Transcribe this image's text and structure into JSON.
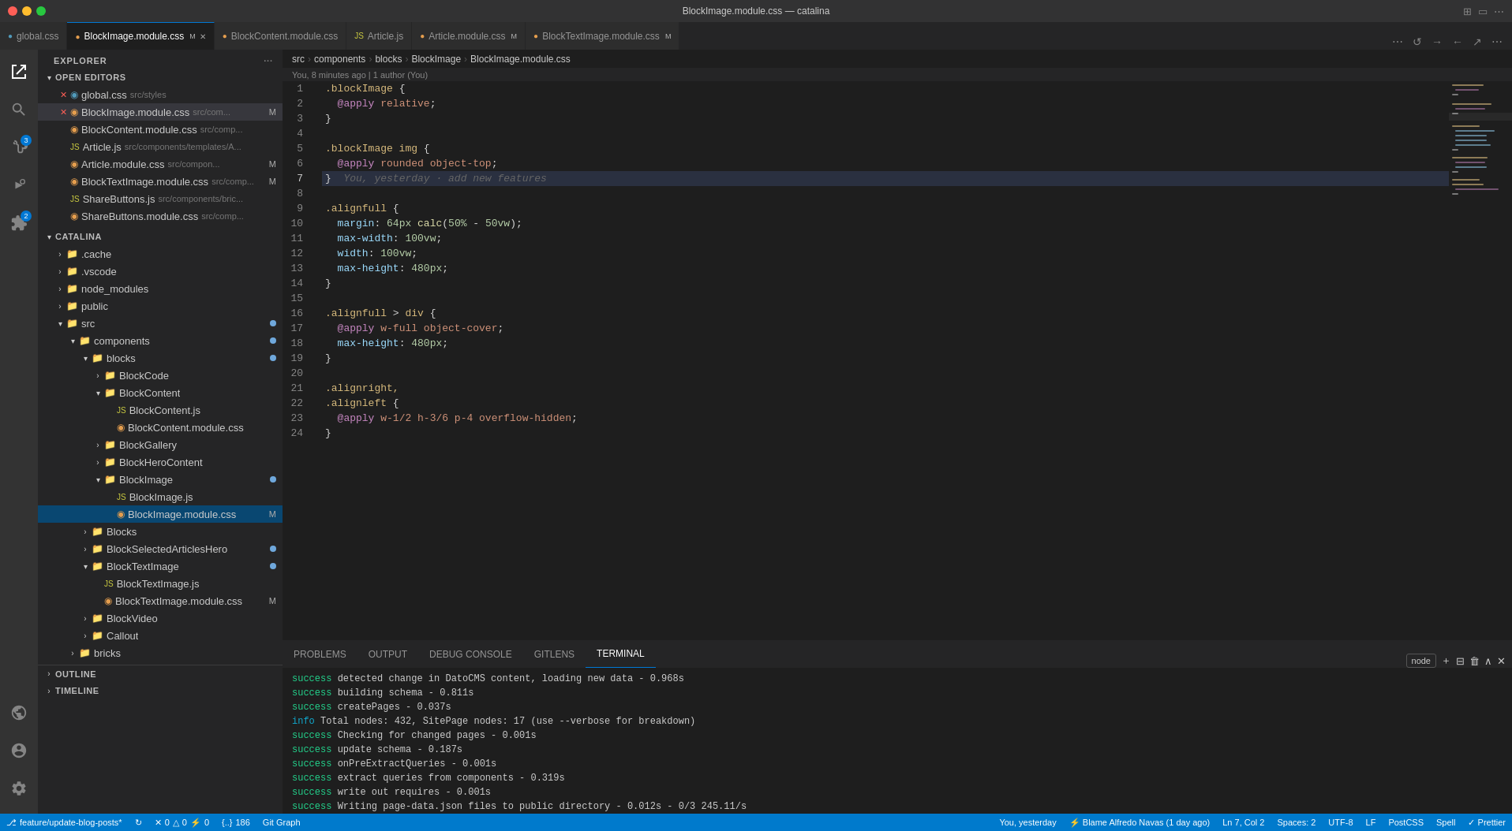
{
  "titleBar": {
    "title": "BlockImage.module.css — catalina",
    "trafficLights": [
      "close",
      "minimize",
      "maximize"
    ]
  },
  "tabs": [
    {
      "id": "global-css",
      "label": "global.css",
      "type": "css",
      "modified": false,
      "active": false
    },
    {
      "id": "blockimage-module-css",
      "label": "BlockImage.module.css",
      "type": "css",
      "modified": true,
      "active": true
    },
    {
      "id": "blockcontent-module-css",
      "label": "BlockContent.module.css",
      "type": "css",
      "modified": false,
      "active": false
    },
    {
      "id": "article-js",
      "label": "Article.js",
      "type": "js",
      "modified": false,
      "active": false
    },
    {
      "id": "article-module-css",
      "label": "Article.module.css",
      "type": "css",
      "modified": true,
      "active": false
    },
    {
      "id": "blocktextimage-module-css",
      "label": "BlockTextImage.module.css",
      "type": "css",
      "modified": true,
      "active": false
    }
  ],
  "activityBar": {
    "icons": [
      {
        "name": "explorer",
        "label": "Explorer",
        "active": true,
        "badge": null
      },
      {
        "name": "search",
        "label": "Search",
        "active": false,
        "badge": null
      },
      {
        "name": "source-control",
        "label": "Source Control",
        "active": false,
        "badge": "3"
      },
      {
        "name": "run",
        "label": "Run",
        "active": false,
        "badge": null
      },
      {
        "name": "extensions",
        "label": "Extensions",
        "active": false,
        "badge": "2"
      },
      {
        "name": "remote",
        "label": "Remote Explorer",
        "active": false,
        "badge": null
      }
    ]
  },
  "sidebar": {
    "title": "EXPLORER",
    "sections": {
      "openEditors": {
        "title": "OPEN EDITORS",
        "files": [
          {
            "name": "global.css",
            "path": "src/styles",
            "type": "css",
            "modified": false,
            "indent": 1
          },
          {
            "name": "BlockImage.module.css",
            "path": "src/com...",
            "type": "css",
            "modified": true,
            "active": true,
            "indent": 1
          },
          {
            "name": "BlockContent.module.css",
            "path": "src/comp...",
            "type": "css",
            "modified": false,
            "indent": 1
          },
          {
            "name": "Article.js",
            "path": "src/components/templates/A...",
            "type": "js",
            "modified": false,
            "indent": 1
          },
          {
            "name": "Article.module.css",
            "path": "src/compon...",
            "type": "css",
            "modified": true,
            "indent": 1
          },
          {
            "name": "BlockTextImage.module.css",
            "path": "src/comp...",
            "type": "css",
            "modified": true,
            "indent": 1
          },
          {
            "name": "ShareButtons.js",
            "path": "src/components/bric...",
            "type": "js",
            "modified": false,
            "indent": 1
          },
          {
            "name": "ShareButtons.module.css",
            "path": "src/comp...",
            "type": "css",
            "modified": false,
            "indent": 1
          }
        ]
      },
      "catalina": {
        "title": "CATALINA",
        "tree": [
          {
            "name": ".cache",
            "type": "folder",
            "indent": 1,
            "collapsed": true
          },
          {
            "name": ".vscode",
            "type": "folder",
            "indent": 1,
            "collapsed": true
          },
          {
            "name": "node_modules",
            "type": "folder",
            "indent": 1,
            "collapsed": true
          },
          {
            "name": "public",
            "type": "folder",
            "indent": 1,
            "collapsed": true
          },
          {
            "name": "src",
            "type": "folder-src",
            "indent": 1,
            "collapsed": false,
            "dirty": true
          },
          {
            "name": "components",
            "type": "folder-src",
            "indent": 2,
            "collapsed": false,
            "dirty": true
          },
          {
            "name": "blocks",
            "type": "folder-src",
            "indent": 3,
            "collapsed": false,
            "dirty": true
          },
          {
            "name": "BlockCode",
            "type": "folder",
            "indent": 4,
            "collapsed": true
          },
          {
            "name": "BlockContent",
            "type": "folder",
            "indent": 4,
            "collapsed": true
          },
          {
            "name": "BlockContent.js",
            "type": "js",
            "indent": 5
          },
          {
            "name": "BlockContent.module.css",
            "type": "css",
            "indent": 5
          },
          {
            "name": "BlockGallery",
            "type": "folder",
            "indent": 4,
            "collapsed": true
          },
          {
            "name": "BlockHeroContent",
            "type": "folder",
            "indent": 4,
            "collapsed": true
          },
          {
            "name": "BlockImage",
            "type": "folder-src",
            "indent": 4,
            "collapsed": false,
            "dirty": true
          },
          {
            "name": "BlockImage.js",
            "type": "js",
            "indent": 5
          },
          {
            "name": "BlockImage.module.css",
            "type": "css",
            "indent": 5,
            "active": true,
            "dirty": true
          },
          {
            "name": "Blocks",
            "type": "folder",
            "indent": 3,
            "collapsed": true
          },
          {
            "name": "BlockSelectedArticlesHero",
            "type": "folder",
            "indent": 3,
            "collapsed": true,
            "dirty": true
          },
          {
            "name": "BlockTextImage",
            "type": "folder",
            "indent": 3,
            "collapsed": true,
            "dirty": true
          },
          {
            "name": "BlockTextImage.js",
            "type": "js",
            "indent": 4
          },
          {
            "name": "BlockTextImage.module.css",
            "type": "css",
            "indent": 4,
            "dirty": true
          },
          {
            "name": "BlockVideo",
            "type": "folder",
            "indent": 3,
            "collapsed": true
          },
          {
            "name": "Callout",
            "type": "folder",
            "indent": 3,
            "collapsed": true
          },
          {
            "name": "bricks",
            "type": "folder",
            "indent": 2,
            "collapsed": true
          }
        ]
      },
      "outline": {
        "title": "OUTLINE"
      },
      "timeline": {
        "title": "TIMELINE"
      }
    }
  },
  "breadcrumb": {
    "parts": [
      "src",
      "components",
      "blocks",
      "BlockImage",
      "BlockImage.module.css"
    ]
  },
  "gitBlame": {
    "text": "You, 8 minutes ago | 1 author (You)"
  },
  "codeLines": [
    {
      "num": 1,
      "tokens": [
        {
          "text": ".blockImage {",
          "class": "css-selector"
        }
      ]
    },
    {
      "num": 2,
      "tokens": [
        {
          "text": "  ",
          "class": ""
        },
        {
          "text": "@apply",
          "class": "css-at"
        },
        {
          "text": " relative",
          "class": "css-value"
        },
        {
          "text": ";",
          "class": "css-punct"
        }
      ]
    },
    {
      "num": 3,
      "tokens": [
        {
          "text": "}",
          "class": "css-punct"
        }
      ]
    },
    {
      "num": 4,
      "tokens": []
    },
    {
      "num": 5,
      "tokens": [
        {
          "text": ".blockImage img {",
          "class": "css-selector"
        }
      ]
    },
    {
      "num": 6,
      "tokens": [
        {
          "text": "  ",
          "class": ""
        },
        {
          "text": "@apply",
          "class": "css-at"
        },
        {
          "text": " rounded object-top",
          "class": "css-value"
        },
        {
          "text": ";",
          "class": "css-punct"
        }
      ]
    },
    {
      "num": 7,
      "tokens": [
        {
          "text": "}",
          "class": "css-punct"
        },
        {
          "text": "  You, yesterday · add new features",
          "class": "inline-ghost"
        }
      ],
      "current": true
    },
    {
      "num": 8,
      "tokens": []
    },
    {
      "num": 9,
      "tokens": [
        {
          "text": ".alignfull {",
          "class": "css-selector"
        }
      ]
    },
    {
      "num": 10,
      "tokens": [
        {
          "text": "  ",
          "class": ""
        },
        {
          "text": "margin",
          "class": "css-property"
        },
        {
          "text": ": ",
          "class": "css-punct"
        },
        {
          "text": "64px",
          "class": "css-value-num"
        },
        {
          "text": " calc(",
          "class": "css-value-func"
        },
        {
          "text": "50%",
          "class": "css-value-num"
        },
        {
          "text": " - ",
          "class": "css-punct"
        },
        {
          "text": "50vw",
          "class": "css-value-num"
        },
        {
          "text": ");",
          "class": "css-punct"
        }
      ]
    },
    {
      "num": 11,
      "tokens": [
        {
          "text": "  ",
          "class": ""
        },
        {
          "text": "max-width",
          "class": "css-property"
        },
        {
          "text": ": ",
          "class": "css-punct"
        },
        {
          "text": "100vw",
          "class": "css-value-num"
        },
        {
          "text": ";",
          "class": "css-punct"
        }
      ]
    },
    {
      "num": 12,
      "tokens": [
        {
          "text": "  ",
          "class": ""
        },
        {
          "text": "width",
          "class": "css-property"
        },
        {
          "text": ": ",
          "class": "css-punct"
        },
        {
          "text": "100vw",
          "class": "css-value-num"
        },
        {
          "text": ";",
          "class": "css-punct"
        }
      ]
    },
    {
      "num": 13,
      "tokens": [
        {
          "text": "  ",
          "class": ""
        },
        {
          "text": "max-height",
          "class": "css-property"
        },
        {
          "text": ": ",
          "class": "css-punct"
        },
        {
          "text": "480px",
          "class": "css-value-num"
        },
        {
          "text": ";",
          "class": "css-punct"
        }
      ]
    },
    {
      "num": 14,
      "tokens": [
        {
          "text": "}",
          "class": "css-punct"
        }
      ]
    },
    {
      "num": 15,
      "tokens": []
    },
    {
      "num": 16,
      "tokens": [
        {
          "text": ".alignfull > div {",
          "class": "css-selector"
        }
      ]
    },
    {
      "num": 17,
      "tokens": [
        {
          "text": "  ",
          "class": ""
        },
        {
          "text": "@apply",
          "class": "css-at"
        },
        {
          "text": " w-full object-cover",
          "class": "css-value"
        },
        {
          "text": ";",
          "class": "css-punct"
        }
      ]
    },
    {
      "num": 18,
      "tokens": [
        {
          "text": "  ",
          "class": ""
        },
        {
          "text": "max-height",
          "class": "css-property"
        },
        {
          "text": ": ",
          "class": "css-punct"
        },
        {
          "text": "480px",
          "class": "css-value-num"
        },
        {
          "text": ";",
          "class": "css-punct"
        }
      ]
    },
    {
      "num": 19,
      "tokens": [
        {
          "text": "}",
          "class": "css-punct"
        }
      ]
    },
    {
      "num": 20,
      "tokens": []
    },
    {
      "num": 21,
      "tokens": [
        {
          "text": ".alignright,",
          "class": "css-selector"
        }
      ]
    },
    {
      "num": 22,
      "tokens": [
        {
          "text": ".alignleft {",
          "class": "css-selector"
        }
      ]
    },
    {
      "num": 23,
      "tokens": [
        {
          "text": "  ",
          "class": ""
        },
        {
          "text": "@apply",
          "class": "css-at"
        },
        {
          "text": " w-1/2 h-3/6 p-4 overflow-hidden",
          "class": "css-value"
        },
        {
          "text": ";",
          "class": "css-punct"
        }
      ]
    },
    {
      "num": 24,
      "tokens": [
        {
          "text": "}",
          "class": "css-punct"
        }
      ]
    }
  ],
  "terminal": {
    "tabs": [
      "PROBLEMS",
      "OUTPUT",
      "DEBUG CONSOLE",
      "GITLENS",
      "TERMINAL"
    ],
    "activeTab": "TERMINAL",
    "lines": [
      {
        "type": "success",
        "text": "detected change in DatoCMS content, loading new data - 0.968s"
      },
      {
        "type": "success",
        "text": "building schema - 0.811s"
      },
      {
        "type": "success",
        "text": "createPages - 0.037s"
      },
      {
        "type": "info",
        "text": "Total nodes: 432, SitePage nodes: 17 (use --verbose for breakdown)"
      },
      {
        "type": "success",
        "text": "Checking for changed pages - 0.001s"
      },
      {
        "type": "success",
        "text": "update schema - 0.187s"
      },
      {
        "type": "success",
        "text": "onPreExtractQueries - 0.001s"
      },
      {
        "type": "success",
        "text": "extract queries from components - 0.319s"
      },
      {
        "type": "success",
        "text": "write out requires - 0.001s"
      },
      {
        "type": "success",
        "text": "Writing page-data.json files to public directory - 0.012s - 0/3 245.11/s"
      }
    ]
  },
  "statusBar": {
    "left": [
      {
        "icon": "⎇",
        "text": "feature/update-blog-posts*"
      },
      {
        "icon": "⚡",
        "text": ""
      },
      {
        "icon": "✕",
        "text": "0"
      },
      {
        "icon": "⚠",
        "text": "0"
      },
      {
        "icon": "△",
        "text": "0"
      },
      {
        "icon": "{}",
        "text": "186"
      },
      {
        "icon": "",
        "text": "Git Graph"
      }
    ],
    "right": [
      {
        "text": "You, yesterday"
      },
      {
        "text": "Blame Alfredo Navas (1 day ago)"
      },
      {
        "text": "Ln 7, Col 2"
      },
      {
        "text": "Spaces: 2"
      },
      {
        "text": "UTF-8"
      },
      {
        "text": "LF"
      },
      {
        "text": "PostCSS"
      },
      {
        "text": "Spell"
      },
      {
        "text": "Prettier"
      }
    ]
  }
}
